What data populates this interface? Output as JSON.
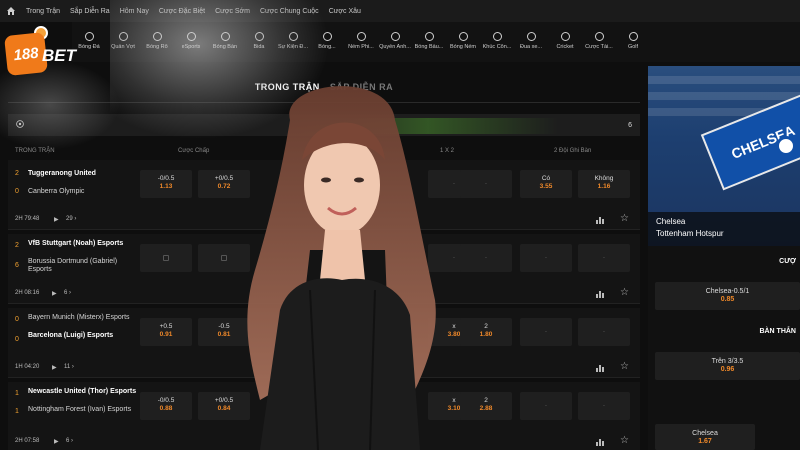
{
  "topnav": {
    "items": [
      "Trong Trận",
      "Sắp Diễn Ra",
      "Hôm Nay",
      "Cược Đặc Biệt",
      "Cược Sớm",
      "Cược Chung Cuộc",
      "Cược Xâu"
    ]
  },
  "logo": {
    "number": "188",
    "brand": "BET"
  },
  "sports": [
    "Bóng Đá",
    "Quần Vợt",
    "Bóng Rổ",
    "eSports",
    "Bóng Bàn",
    "Bida",
    "Sự Kiện Đ...",
    "Bóng...",
    "Ném Phi...",
    "Quyền Anh...",
    "Bóng Bầu...",
    "Bóng Ném",
    "Khúc Côn...",
    "Đua xe...",
    "Cricket",
    "Cược Tài...",
    "Golf"
  ],
  "heading": {
    "active": "TRONG TRẬN",
    "next": "SẮP DIỄN RA"
  },
  "league_bar": {
    "count": "6"
  },
  "columns": {
    "teams": "TRONG TRẬN",
    "handicap": "Cược Chấp",
    "onextwo": "1 X 2",
    "btts": "2 Đội Ghi Bàn"
  },
  "matches": [
    {
      "home_score": "2",
      "away_score": "0",
      "home": "Tuggeranong United",
      "away": "Canberra Olympic",
      "time": "2H 79:48",
      "more": "29",
      "hdp_home": {
        "line": "-0/0.5",
        "odds": "1.13"
      },
      "hdp_away": {
        "line": "+0/0.5",
        "odds": "0.72"
      },
      "btts_yes": {
        "line": "Có",
        "odds": "3.55"
      },
      "btts_no": {
        "line": "Không",
        "odds": "1.16"
      }
    },
    {
      "home_score": "2",
      "away_score": "6",
      "home": "VfB Stuttgart (Noah) Esports",
      "away": "Borussia Dortmund (Gabriel) Esports",
      "time": "2H 08:16",
      "more": "6"
    },
    {
      "home_score": "0",
      "away_score": "0",
      "home": "Bayern Munich (Misterx) Esports",
      "away": "Barcelona (Luigi) Esports",
      "time": "1H 04:20",
      "more": "11",
      "hdp_home": {
        "line": "+0.5",
        "odds": "0.91"
      },
      "hdp_away": {
        "line": "-0.5",
        "odds": "0.81"
      },
      "x": {
        "line": "x",
        "odds": "3.80"
      },
      "two": {
        "line": "2",
        "odds": "1.80"
      }
    },
    {
      "home_score": "1",
      "away_score": "1",
      "home": "Newcastle United (Thor) Esports",
      "away": "Nottingham Forest (Ivan) Esports",
      "time": "2H 07:58",
      "more": "6",
      "hdp_home": {
        "line": "-0/0.5",
        "odds": "0.88"
      },
      "hdp_away": {
        "line": "+0/0.5",
        "odds": "0.84"
      },
      "x": {
        "line": "x",
        "odds": "3.10"
      },
      "two": {
        "line": "2",
        "odds": "2.88"
      }
    }
  ],
  "empty_cell": "-",
  "right": {
    "banner": "CHELSEA",
    "home": "Chelsea",
    "away": "Tottenham Hotspur",
    "sec1": "CƯỢ",
    "cell1": {
      "line": "Chelsea-0.5/1",
      "odds": "0.85"
    },
    "sec2": "BÀN THẮN",
    "cell2": {
      "line": "Trên 3/3.5",
      "odds": "0.96"
    },
    "cell3": {
      "line": "Chelsea",
      "odds": "1.67"
    }
  },
  "colors": {
    "accent": "#f07a1a",
    "odds": "#f0892a",
    "score": "#f0a030"
  }
}
